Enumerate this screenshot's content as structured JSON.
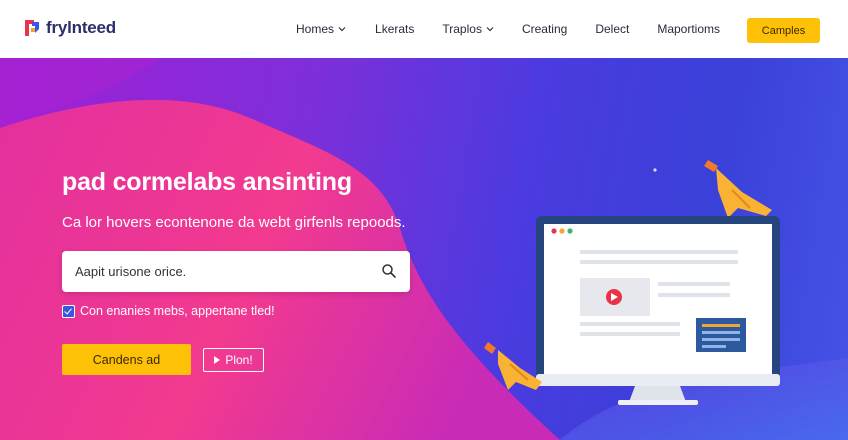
{
  "brand": {
    "name": "frylnteed"
  },
  "nav": {
    "items": [
      {
        "label": "Homes",
        "dropdown": true
      },
      {
        "label": "Lkerats",
        "dropdown": false
      },
      {
        "label": "Traplos",
        "dropdown": true
      },
      {
        "label": "Creating",
        "dropdown": false
      },
      {
        "label": "Delect",
        "dropdown": false
      },
      {
        "label": "Maportioms",
        "dropdown": false
      }
    ],
    "cta_label": "Camples"
  },
  "hero": {
    "title": "pad cormelabs ansinting",
    "subtitle": "Ca lor hovers econtenone da webt girfenls repoods.",
    "search": {
      "value": "Aapit urisone orice.",
      "placeholder": "Aapit urisone orice."
    },
    "checkbox": {
      "label": "Con enanies mebs, appertane tled!",
      "checked": true
    },
    "primary_button": "Candens ad",
    "secondary_button": "Plon!"
  },
  "colors": {
    "accent": "#ffc107",
    "brand_dark": "#2b2f6b",
    "hero_pink": "#f0359a",
    "hero_blue": "#3a40d8"
  },
  "icons": {
    "search": "search-icon",
    "chevron": "chevron-down-icon",
    "play": "play-icon",
    "rocket": "rocket-icon"
  }
}
